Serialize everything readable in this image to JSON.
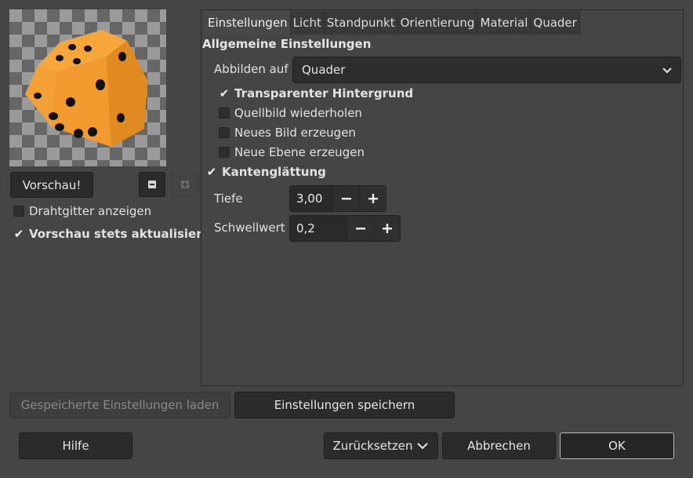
{
  "preview_panel": {
    "preview_button": "Vorschau!",
    "zoom_out_icon": "minus-icon",
    "zoom_in_icon": "plus-icon",
    "show_wireframe": {
      "label": "Drahtgitter anzeigen",
      "checked": false
    },
    "always_update": {
      "label": "Vorschau stets aktualisieren",
      "checked": true
    }
  },
  "tabs": [
    {
      "label": "Einstellungen",
      "active": true
    },
    {
      "label": "Licht",
      "active": false
    },
    {
      "label": "Standpunkt",
      "active": false
    },
    {
      "label": "Orientierung",
      "active": false
    },
    {
      "label": "Material",
      "active": false
    },
    {
      "label": "Quader",
      "active": false
    }
  ],
  "settings": {
    "section_title": "Allgemeine Einstellungen",
    "map_to_label": "Abbilden auf",
    "map_to_value": "Quader",
    "options": [
      {
        "label": "Transparenter Hintergrund",
        "checked": true
      },
      {
        "label": "Quellbild wiederholen",
        "checked": false
      },
      {
        "label": "Neues Bild erzeugen",
        "checked": false
      },
      {
        "label": "Neue Ebene erzeugen",
        "checked": false
      }
    ],
    "antialiasing": {
      "label": "Kantenglättung",
      "checked": true
    },
    "depth": {
      "label": "Tiefe",
      "value": "3,00"
    },
    "threshold": {
      "label": "Schwellwert",
      "value": "0,2"
    }
  },
  "buttons": {
    "load_settings": "Gespeicherte Einstellungen laden",
    "save_settings": "Einstellungen speichern",
    "help": "Hilfe",
    "reset": "Zurücksetzen",
    "cancel": "Abbrechen",
    "ok": "OK"
  },
  "colors": {
    "background": "#454545",
    "dice": "#f29a2e",
    "pips": "#111111"
  }
}
